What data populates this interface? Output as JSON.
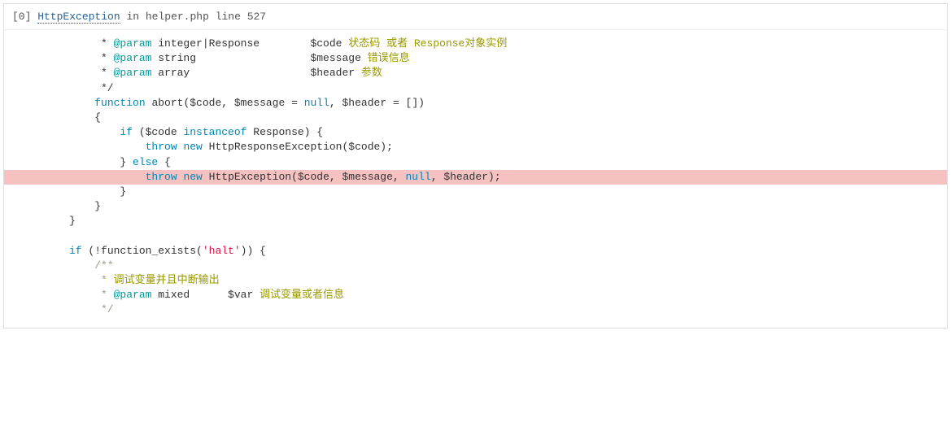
{
  "header": {
    "index": "[0]",
    "exception": "HttpException",
    "in": "in",
    "file": "helper.php line 527"
  },
  "code": {
    "lines": [
      {
        "html": "     * <span class='c-tag'>@param</span> integer|Response        $code <span class='c-brown'>状态码 或者 Response对象实例</span>"
      },
      {
        "html": "     * <span class='c-tag'>@param</span> string                  $message <span class='c-brown'>错误信息</span>"
      },
      {
        "html": "     * <span class='c-tag'>@param</span> array                   $header <span class='c-brown'>参数</span>"
      },
      {
        "html": "     */"
      },
      {
        "html": "    <span class='c-kw'>function</span> abort($code, $message = <span class='c-kw'>null</span>, $header = [])"
      },
      {
        "html": "    {"
      },
      {
        "html": "        <span class='c-kw'>if</span> ($code <span class='c-kw'>instanceof</span> Response) {"
      },
      {
        "html": "            <span class='c-kw'>throw</span> <span class='c-kw'>new</span> HttpResponseException($code);"
      },
      {
        "html": "        } <span class='c-kw'>else</span> {"
      },
      {
        "html": "            <span class='c-kw'>throw</span> <span class='c-kw'>new</span> HttpException($code, $message, <span class='c-kw'>null</span>, $header);",
        "hl": true
      },
      {
        "html": "        }"
      },
      {
        "html": "    }"
      },
      {
        "html": "}"
      },
      {
        "html": ""
      },
      {
        "html": "<span class='c-kw'>if</span> (!function_exists(<span class='c-string'>'halt'</span>)) {"
      },
      {
        "html": "    <span class='c-doc'>/**</span>"
      },
      {
        "html": "<span class='c-doc'>     * </span><span class='c-brown'>调试变量并且中断输出</span>"
      },
      {
        "html": "<span class='c-doc'>     * </span><span class='c-tag'>@param</span> mixed      $var <span class='c-brown'>调试变量或者信息</span>"
      },
      {
        "html": "<span class='c-doc'>     */</span>"
      }
    ]
  }
}
